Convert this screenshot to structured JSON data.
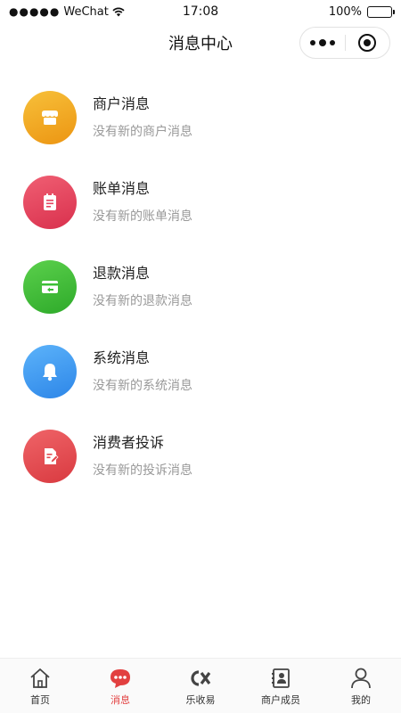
{
  "status_bar": {
    "carrier": "WeChat",
    "time": "17:08",
    "battery": "100%"
  },
  "nav": {
    "title": "消息中心"
  },
  "messages": [
    {
      "title": "商户消息",
      "subtitle": "没有新的商户消息",
      "icon": "shop-icon",
      "color": "#f2a51f"
    },
    {
      "title": "账单消息",
      "subtitle": "没有新的账单消息",
      "icon": "bill-icon",
      "color": "#e54560"
    },
    {
      "title": "退款消息",
      "subtitle": "没有新的退款消息",
      "icon": "refund-icon",
      "color": "#3cbf36"
    },
    {
      "title": "系统消息",
      "subtitle": "没有新的系统消息",
      "icon": "bell-icon",
      "color": "#3a9af0"
    },
    {
      "title": "消费者投诉",
      "subtitle": "没有新的投诉消息",
      "icon": "complaint-icon",
      "color": "#e2494e"
    }
  ],
  "tabs": [
    {
      "label": "首页",
      "icon": "home-icon",
      "active": false
    },
    {
      "label": "消息",
      "icon": "message-icon",
      "active": true
    },
    {
      "label": "乐收易",
      "icon": "lsy-logo-icon",
      "active": false
    },
    {
      "label": "商户成员",
      "icon": "member-icon",
      "active": false
    },
    {
      "label": "我的",
      "icon": "profile-icon",
      "active": false
    }
  ],
  "colors": {
    "accent": "#e24040",
    "text_primary": "#222222",
    "text_secondary": "#999999"
  }
}
